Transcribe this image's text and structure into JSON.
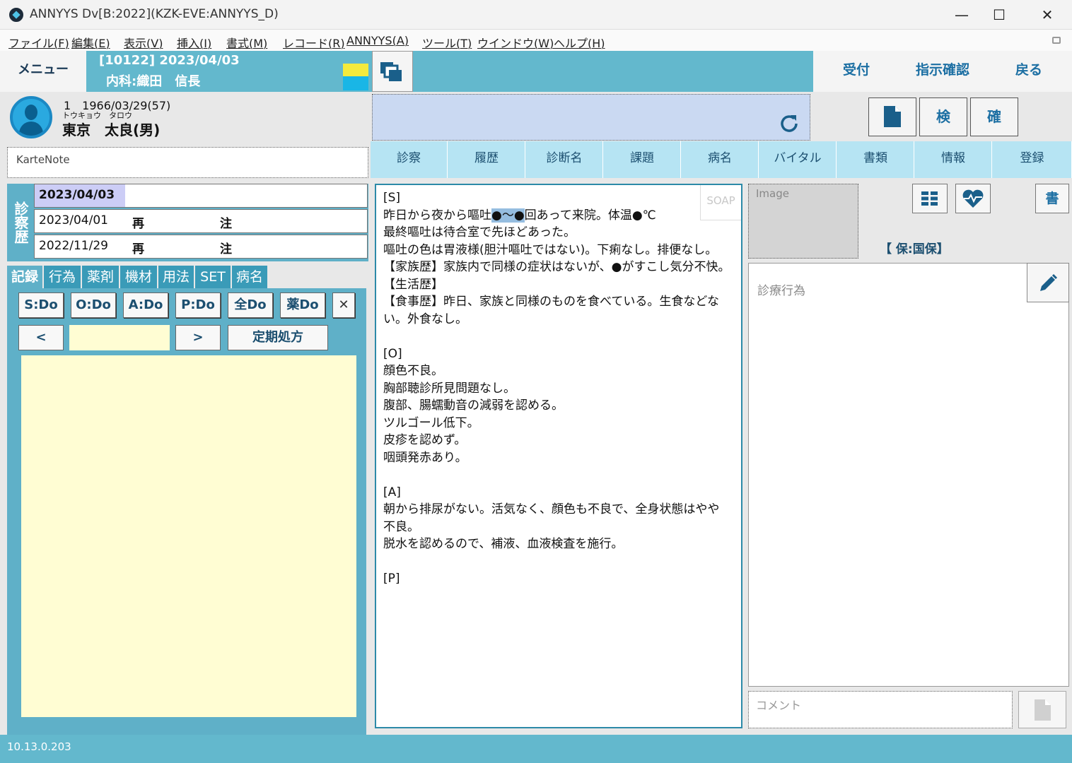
{
  "window": {
    "title": "ANNYYS Dv[B:2022](KZK-EVE:ANNYYS_D)",
    "minimize": "—",
    "maximize": "☐",
    "close": "✕"
  },
  "menubar": [
    "ファイル(F)",
    "編集(E)",
    "表示(V)",
    "挿入(I)",
    "書式(M)",
    "レコード(R)",
    "ANNYYS(A)",
    "ツール(T)",
    "ウインドウ(W)",
    "ヘルプ(H)"
  ],
  "header": {
    "menu": "メニュー",
    "visit": "[10122] 2023/04/03",
    "dept": "内科:織田　信長",
    "reception": "受付",
    "order_confirm": "指示確認",
    "back": "戻る"
  },
  "patient": {
    "id_birth": "1　1966/03/29(57)",
    "kana": "トウキョウ　タロウ",
    "name": "東京　太良(男)"
  },
  "karte_note": {
    "placeholder": "KarteNote"
  },
  "history": {
    "label": "診察歴",
    "rows": [
      {
        "date": "2023/04/03",
        "type": "",
        "note": ""
      },
      {
        "date": "2023/04/01",
        "type": "再",
        "note": "注"
      },
      {
        "date": "2022/11/29",
        "type": "再",
        "note": "注"
      }
    ]
  },
  "left_tabs": [
    "記録",
    "行為",
    "薬剤",
    "機材",
    "用法",
    "SET",
    "病名"
  ],
  "do_buttons": [
    "S:Do",
    "O:Do",
    "A:Do",
    "P:Do",
    "全Do",
    "薬Do"
  ],
  "close_x": "✕",
  "nav": {
    "prev": "<",
    "next": ">",
    "regular_rx": "定期処方",
    "field_value": ""
  },
  "right_buttons": {
    "kensa": "検",
    "kakunin": "確"
  },
  "content_tabs": [
    "診察",
    "履歴",
    "診断名",
    "課題",
    "病名",
    "バイタル",
    "書類",
    "情報",
    "登録"
  ],
  "soap": {
    "tag": "SOAP",
    "s_head": "[S]",
    "s1a": "昨日から夜から嘔吐",
    "s1h": "●～●",
    "s1b": "回あって来院。体温●℃",
    "s_rest": "最終嘔吐は待合室で先ほどあった。\n嘔吐の色は胃液様(胆汁嘔吐ではない)。下痢なし。排便なし。\n【家族歴】家族内で同様の症状はないが、●がすこし気分不快。\n【生活歴】\n【食事歴】昨日、家族と同様のものを食べている。生食などな\nい。外食なし。\n\n[O]\n顔色不良。\n胸部聴診所見問題なし。\n腹部、腸蠕動音の減弱を認める。\nツルゴール低下。\n皮疹を認めず。\n咽頭発赤あり。\n\n[A]\n朝から排尿がない。活気なく、顔色も不良で、全身状態はやや\n不良。\n脱水を認めるので、補液、血液検査を施行。\n\n[P]"
  },
  "image_label": "Image",
  "write_btn": "書",
  "insurance": "【 保:国保】",
  "shinryo_label": "診療行為",
  "comment_placeholder": "コメント",
  "status_version": "10.13.0.203",
  "colors": {
    "header": "#63b8cd",
    "tab": "#b6e4f3",
    "notes": "#fffdd3",
    "search": "#cad9f2"
  }
}
